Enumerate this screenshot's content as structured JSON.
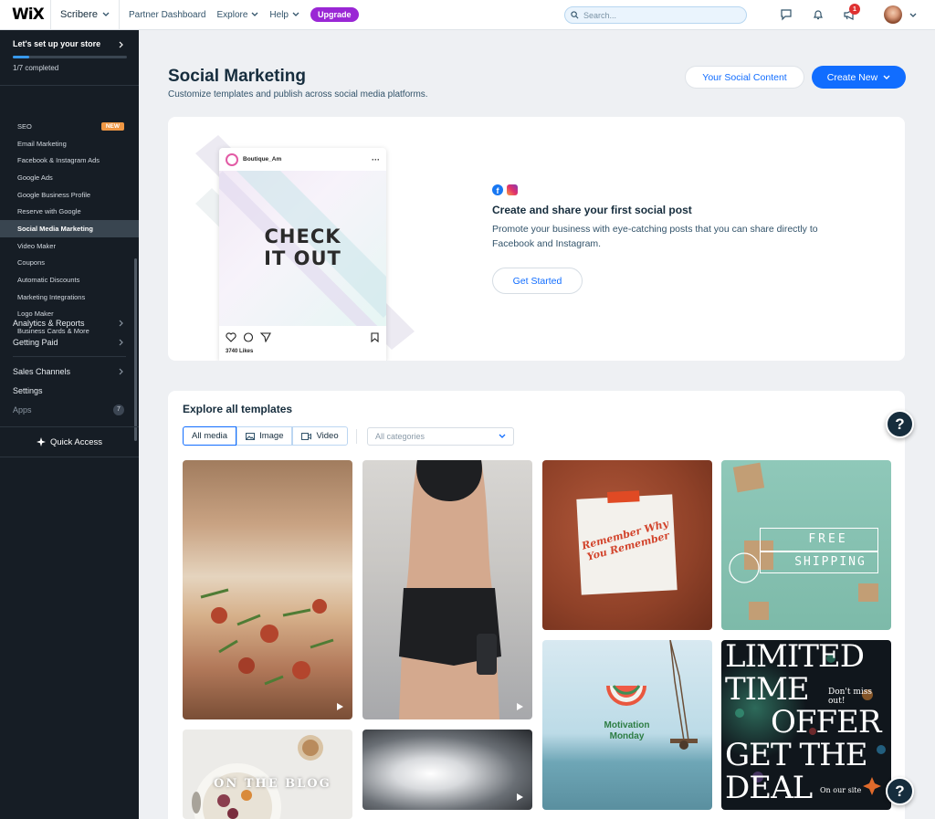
{
  "topbar": {
    "logo": "WiX",
    "site_name": "Scribere",
    "nav": [
      "Partner Dashboard",
      "Explore",
      "Help"
    ],
    "upgrade": "Upgrade",
    "search_placeholder": "Search...",
    "notification_count": "1"
  },
  "sidebar": {
    "setup_title": "Let's set up your store",
    "setup_progress": 0.14,
    "setup_status": "1/7 completed",
    "sub_items": [
      {
        "label": "SEO",
        "badge": "NEW"
      },
      {
        "label": "Email Marketing"
      },
      {
        "label": "Facebook & Instagram Ads"
      },
      {
        "label": "Google Ads"
      },
      {
        "label": "Google Business Profile"
      },
      {
        "label": "Reserve with Google"
      },
      {
        "label": "Social Media Marketing",
        "active": true
      },
      {
        "label": "Video Maker"
      },
      {
        "label": "Coupons"
      },
      {
        "label": "Automatic Discounts"
      },
      {
        "label": "Marketing Integrations"
      },
      {
        "label": "Logo Maker"
      },
      {
        "label": "Business Cards & More"
      }
    ],
    "main_items": {
      "analytics": "Analytics & Reports",
      "getting_paid": "Getting Paid",
      "sales_channels": "Sales Channels",
      "settings": "Settings",
      "apps": "Apps",
      "apps_count": "7"
    },
    "quick_access": "Quick Access"
  },
  "page": {
    "title": "Social Marketing",
    "subtitle": "Customize templates and publish across social media platforms.",
    "social_content_button": "Your Social Content",
    "create_new_button": "Create New"
  },
  "hero": {
    "post_account": "Boutique_Am",
    "post_text_line1": "CHECK",
    "post_text_line2": "IT OUT",
    "post_likes": "3740 Likes",
    "title": "Create and share your first social post",
    "description": "Promote your business with eye-catching posts that you can share directly to Facebook and Instagram.",
    "cta": "Get Started"
  },
  "templates": {
    "title": "Explore all templates",
    "filters": [
      "All media",
      "Image",
      "Video"
    ],
    "category_placeholder": "All categories",
    "tiles": {
      "note_line1": "Remember Why",
      "note_line2": "You Remember",
      "shipping_line1": "FREE",
      "shipping_line2": "SHIPPING",
      "motivation_line1": "Motivation",
      "motivation_line2": "Monday",
      "blog": "ON THE BLOG",
      "limited_line1": "LIMITED",
      "limited_line2": "TIME",
      "limited_line3": "OFFER",
      "limited_line4": "GET THE",
      "limited_line5": "DEAL",
      "dont_miss": "Don't miss out!",
      "on_site": "On our site"
    }
  },
  "help_label": "?",
  "colors": {
    "accent": "#116dff",
    "upgrade": "#9a27d5",
    "sidebar_bg": "#161d25",
    "new_badge": "#ef9744"
  }
}
